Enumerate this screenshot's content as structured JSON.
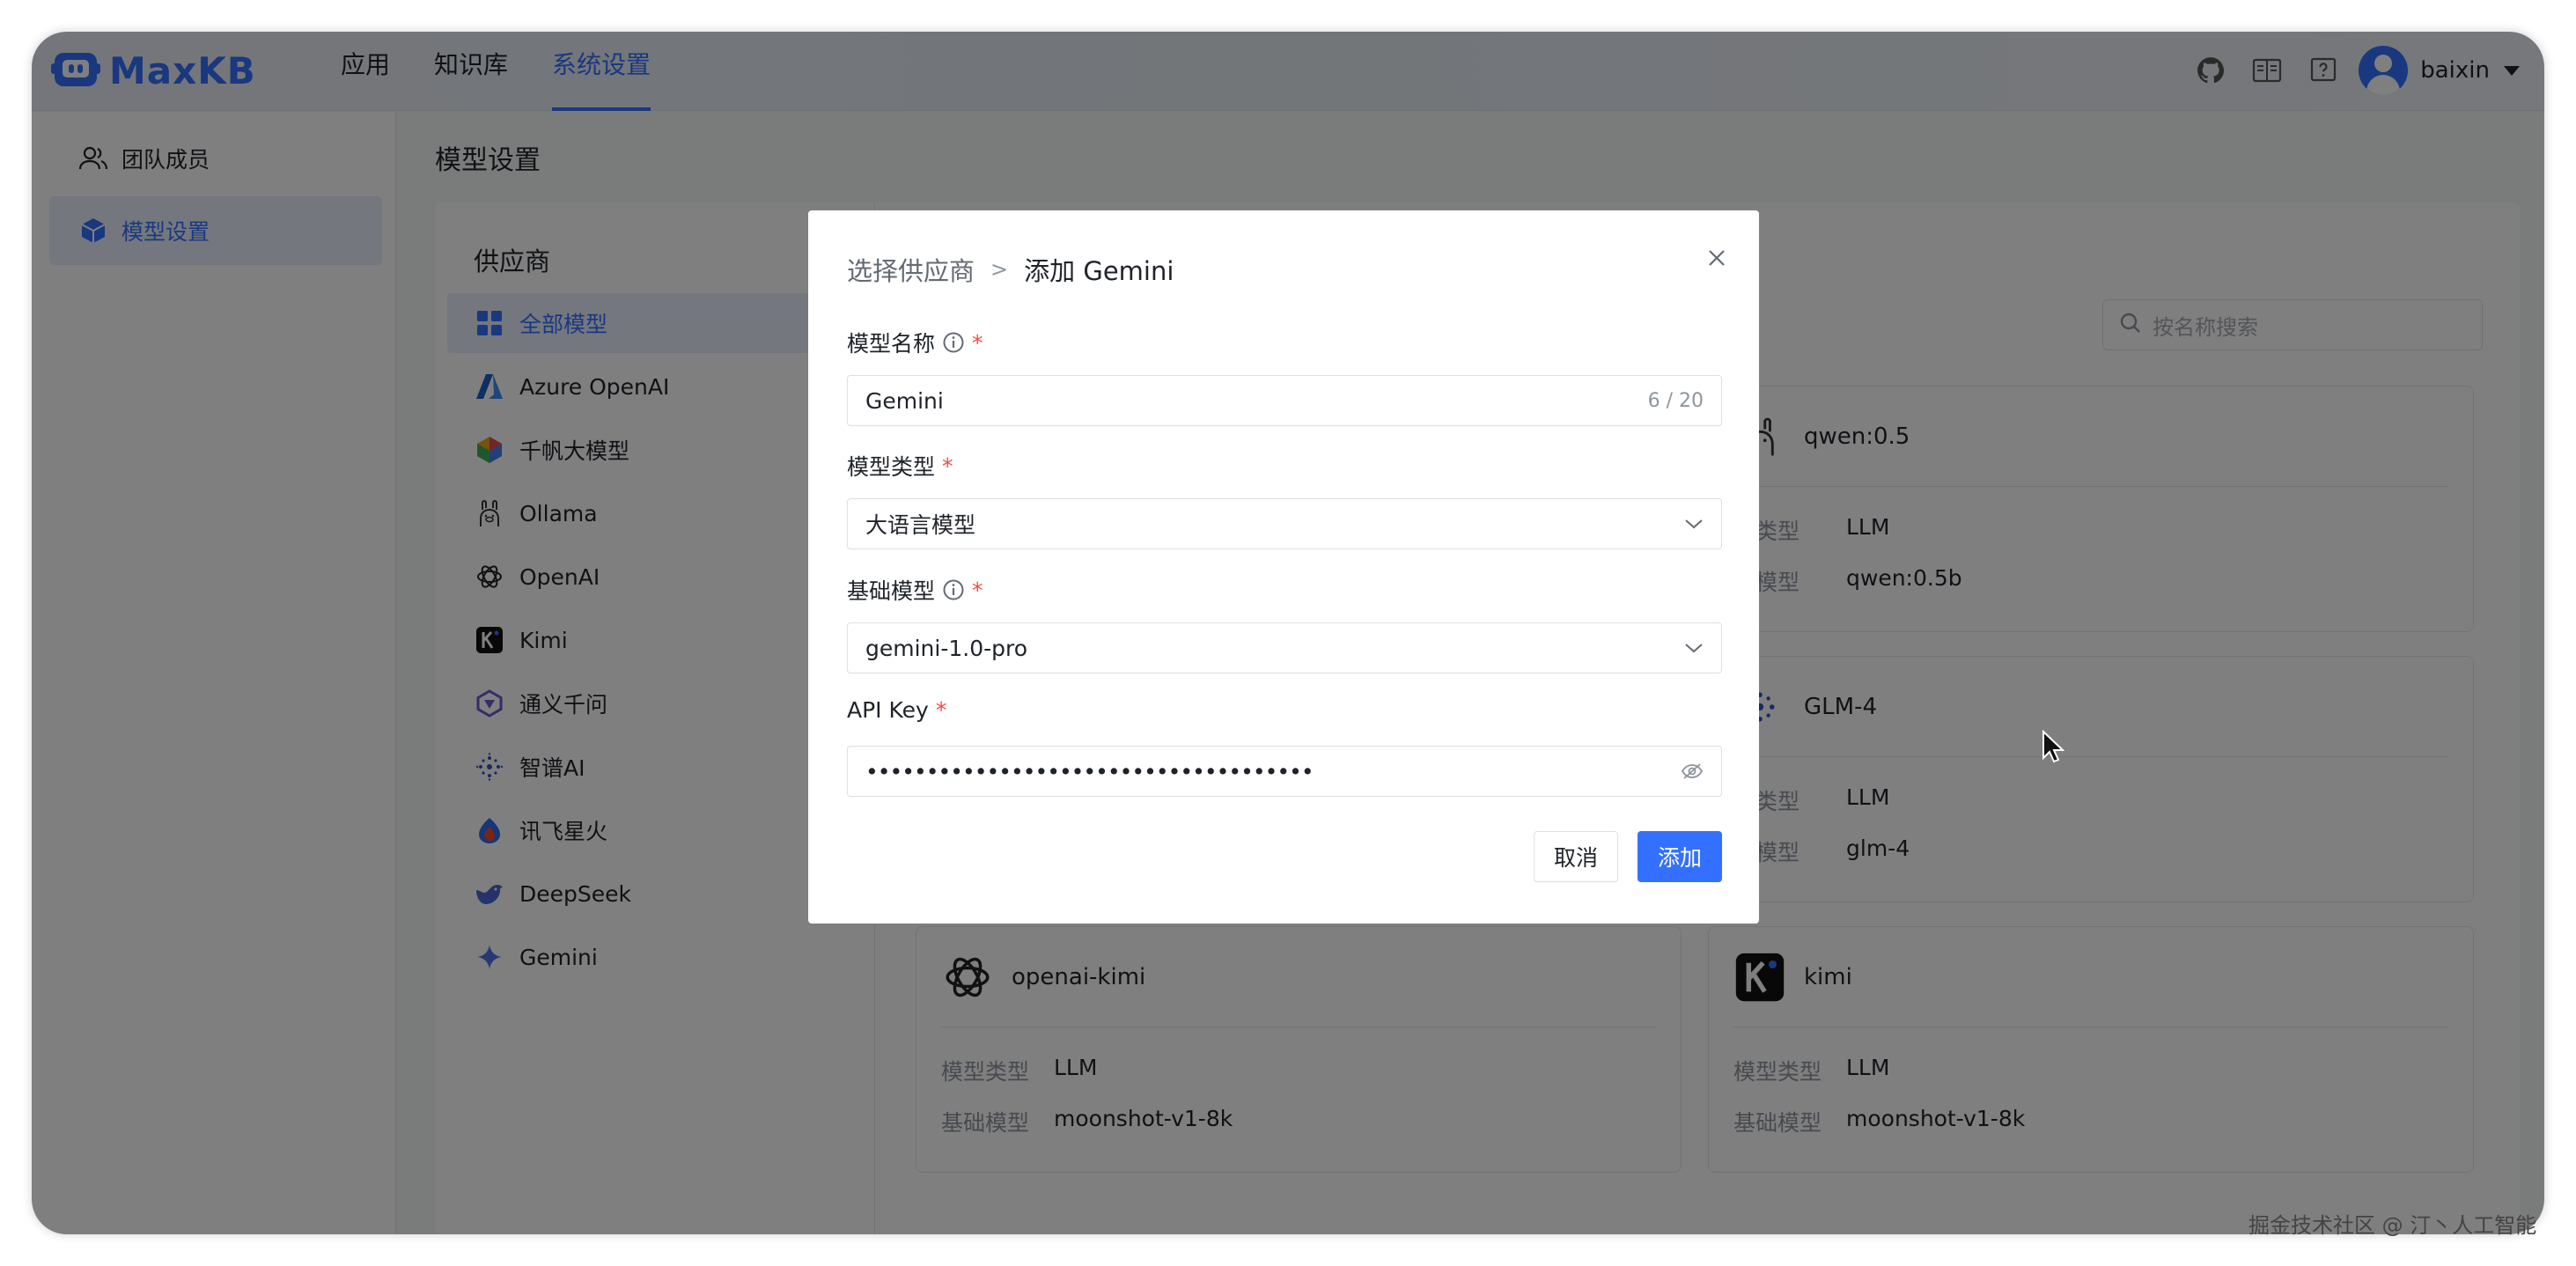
{
  "app": {
    "logo_text": "MaxKB"
  },
  "top_nav": {
    "items": [
      "应用",
      "知识库",
      "系统设置"
    ],
    "active": "系统设置"
  },
  "header": {
    "username": "baixin",
    "icons": [
      "github-icon",
      "book-icon",
      "help-icon"
    ]
  },
  "sidebar": {
    "items": [
      {
        "label": "团队成员",
        "icon": "users-icon"
      },
      {
        "label": "模型设置",
        "icon": "cube-icon"
      }
    ],
    "active": "模型设置"
  },
  "page": {
    "title": "模型设置"
  },
  "providers": {
    "title": "供应商",
    "items": [
      "全部模型",
      "Azure OpenAI",
      "千帆大模型",
      "Ollama",
      "OpenAI",
      "Kimi",
      "通义千问",
      "智谱AI",
      "讯飞星火",
      "DeepSeek",
      "Gemini"
    ],
    "active": "全部模型"
  },
  "search": {
    "placeholder": "按名称搜索"
  },
  "models": [
    {
      "name": "qwen:0.5",
      "type_label": "型类型",
      "type": "LLM",
      "base_label": "础模型",
      "base": "qwen:0.5b",
      "icon": "ollama-icon"
    },
    {
      "name": "GLM-4",
      "type_label": "型类型",
      "type": "LLM",
      "base_label": "础模型",
      "base": "glm-4",
      "icon": "zhipu-icon"
    },
    {
      "name": "openai-kimi",
      "type_label": "模型类型",
      "type": "LLM",
      "base_label": "基础模型",
      "base": "moonshot-v1-8k",
      "icon": "openai-icon"
    },
    {
      "name": "kimi",
      "type_label": "模型类型",
      "type": "LLM",
      "base_label": "基础模型",
      "base": "moonshot-v1-8k",
      "icon": "kimi-icon"
    }
  ],
  "dialog": {
    "breadcrumb_parent": "选择供应商",
    "breadcrumb_sep": ">",
    "title": "添加 Gemini",
    "fields": {
      "model_name": {
        "label": "模型名称",
        "value": "Gemini",
        "count": "6 / 20"
      },
      "model_type": {
        "label": "模型类型",
        "value": "大语言模型"
      },
      "base_model": {
        "label": "基础模型",
        "value": "gemini-1.0-pro"
      },
      "api_key": {
        "label": "API Key",
        "value": "•••••••••••••••••••••••••••••••••••••"
      }
    },
    "required_mark": "*",
    "cancel_label": "取消",
    "submit_label": "添加"
  },
  "watermark": "掘金技术社区 @ 汀丶人工智能",
  "colors": {
    "accent": "#3370ff",
    "required": "#f54a45"
  }
}
